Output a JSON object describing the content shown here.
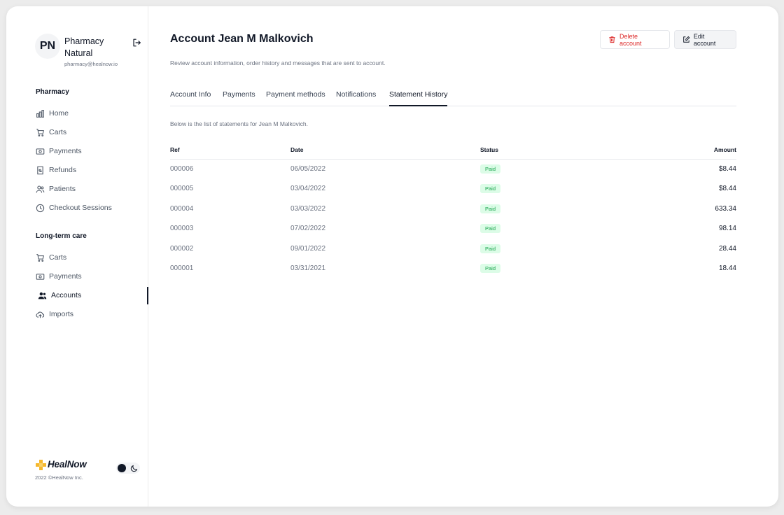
{
  "org": {
    "initials": "PN",
    "name": "Pharmacy Natural",
    "email": "pharmacy@healnow.io"
  },
  "sidebar": {
    "pharmacy": {
      "title": "Pharmacy",
      "items": [
        {
          "label": "Home",
          "icon": "bar-chart-icon"
        },
        {
          "label": "Carts",
          "icon": "cart-icon"
        },
        {
          "label": "Payments",
          "icon": "money-icon"
        },
        {
          "label": "Refunds",
          "icon": "refund-receipt-icon"
        },
        {
          "label": "Patients",
          "icon": "users-icon"
        },
        {
          "label": "Checkout Sessions",
          "icon": "clock-icon"
        }
      ]
    },
    "ltc": {
      "title": "Long-term care",
      "items": [
        {
          "label": "Carts",
          "icon": "cart-icon"
        },
        {
          "label": "Payments",
          "icon": "money-icon"
        },
        {
          "label": "Accounts",
          "icon": "users-filled-icon",
          "active": true
        },
        {
          "label": "Imports",
          "icon": "cloud-upload-icon"
        }
      ]
    }
  },
  "footer": {
    "logo": "HealNow",
    "copyright": "2022 ©HealNow Inc."
  },
  "header": {
    "title": "Account Jean M Malkovich",
    "subtitle": "Review account information, order history and messages that are sent to account.",
    "delete_label": "Delete account",
    "edit_label": "Edit account"
  },
  "tabs": [
    {
      "label": "Account Info"
    },
    {
      "label": "Payments"
    },
    {
      "label": "Payment methods"
    },
    {
      "label": "Notifications"
    },
    {
      "label": "Statement History",
      "active": true
    }
  ],
  "statements": {
    "intro": "Below is the list of statements for Jean M Malkovich.",
    "columns": {
      "ref": "Ref",
      "date": "Date",
      "status": "Status",
      "amount": "Amount"
    },
    "rows": [
      {
        "ref": "000006",
        "date": "06/05/2022",
        "status": "Paid",
        "amount": "$8.44"
      },
      {
        "ref": "000005",
        "date": "03/04/2022",
        "status": "Paid",
        "amount": "$8.44"
      },
      {
        "ref": "000004",
        "date": "03/03/2022",
        "status": "Paid",
        "amount": "633.34"
      },
      {
        "ref": "000003",
        "date": "07/02/2022",
        "status": "Paid",
        "amount": "98.14"
      },
      {
        "ref": "000002",
        "date": "09/01/2022",
        "status": "Paid",
        "amount": "28.44"
      },
      {
        "ref": "000001",
        "date": "03/31/2021",
        "status": "Paid",
        "amount": "18.44"
      }
    ]
  },
  "colors": {
    "accent": "#111827",
    "danger": "#dc2626",
    "paid_text": "#16a34a",
    "paid_bg": "#dcfce7",
    "logo_cross": "#f5b82e"
  }
}
